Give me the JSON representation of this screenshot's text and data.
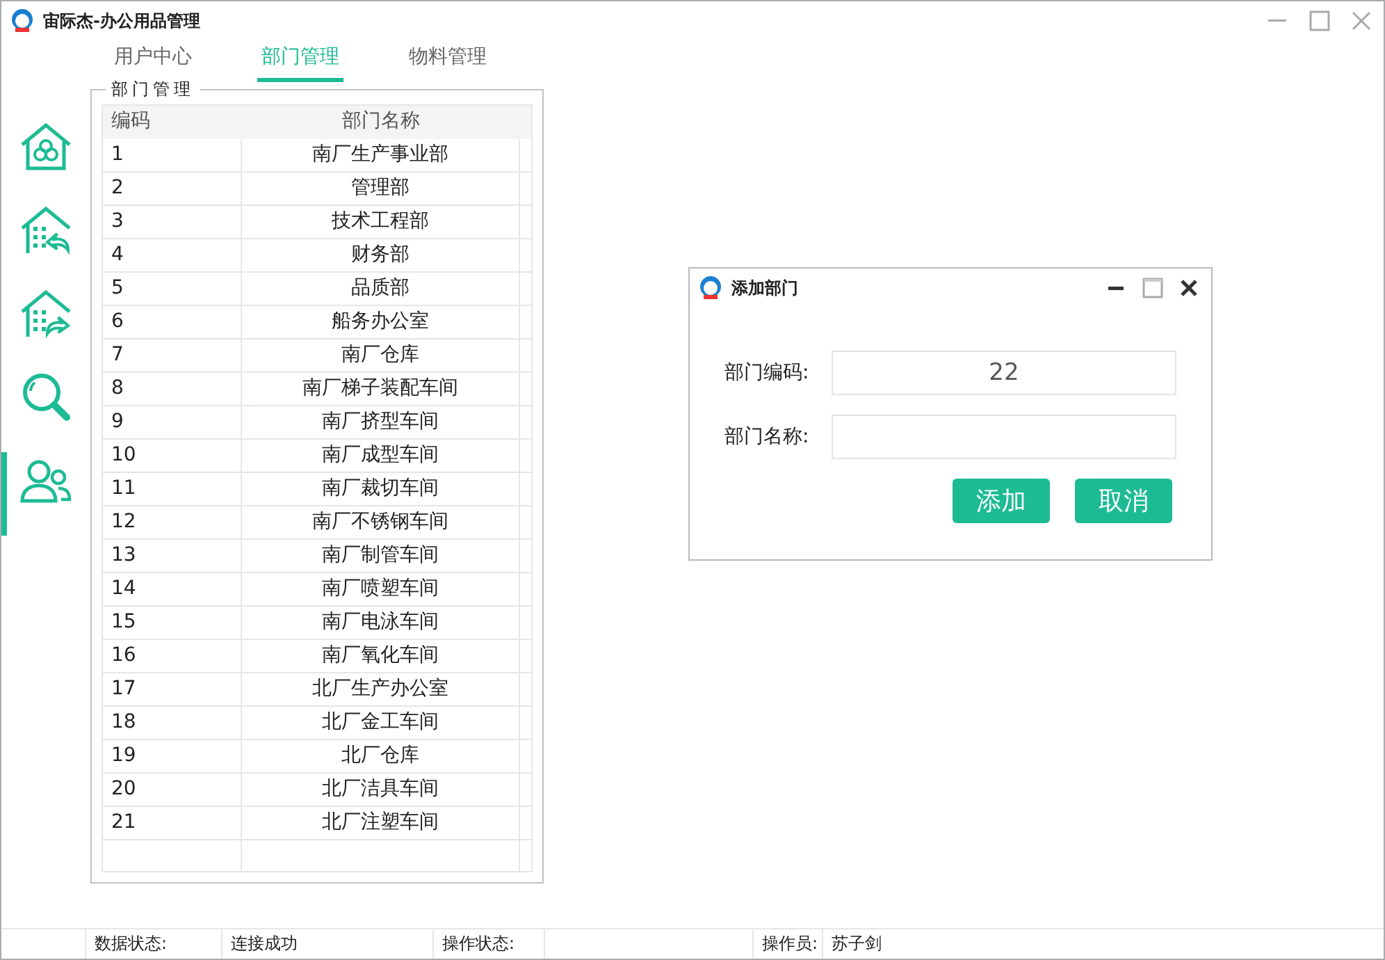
{
  "window": {
    "title": "宙际杰-办公用品管理"
  },
  "tabs": [
    {
      "label": "用户中心",
      "selected": false
    },
    {
      "label": "部门管理",
      "selected": true
    },
    {
      "label": "物料管理",
      "selected": false
    }
  ],
  "sidebar": {
    "items": [
      {
        "kind": "home",
        "selected": false
      },
      {
        "kind": "building-in",
        "selected": false
      },
      {
        "kind": "building-out",
        "selected": false
      },
      {
        "kind": "search",
        "selected": false
      },
      {
        "kind": "users",
        "selected": true
      }
    ]
  },
  "group": {
    "title": "部门管理"
  },
  "table": {
    "columns": [
      "编码",
      "部门名称"
    ],
    "rows": [
      [
        "1",
        "南厂生产事业部"
      ],
      [
        "2",
        "管理部"
      ],
      [
        "3",
        "技术工程部"
      ],
      [
        "4",
        "财务部"
      ],
      [
        "5",
        "品质部"
      ],
      [
        "6",
        "船务办公室"
      ],
      [
        "7",
        "南厂仓库"
      ],
      [
        "8",
        "南厂梯子装配车间"
      ],
      [
        "9",
        "南厂挤型车间"
      ],
      [
        "10",
        "南厂成型车间"
      ],
      [
        "11",
        "南厂裁切车间"
      ],
      [
        "12",
        "南厂不锈钢车间"
      ],
      [
        "13",
        "南厂制管车间"
      ],
      [
        "14",
        "南厂喷塑车间"
      ],
      [
        "15",
        "南厂电泳车间"
      ],
      [
        "16",
        "南厂氧化车间"
      ],
      [
        "17",
        "北厂生产办公室"
      ],
      [
        "18",
        "北厂金工车间"
      ],
      [
        "19",
        "北厂仓库"
      ],
      [
        "20",
        "北厂洁具车间"
      ],
      [
        "21",
        "北厂注塑车间"
      ]
    ]
  },
  "dialog": {
    "title": "添加部门",
    "fields": [
      {
        "label": "部门编码:",
        "value": "22"
      },
      {
        "label": "部门名称:"
      }
    ],
    "buttons": [
      "添加",
      "取消"
    ]
  },
  "status_bar": [
    {
      "label": "数据状态:",
      "value": "连接成功"
    },
    {
      "label": "操作状态:"
    },
    {
      "label": "操作员:",
      "value": "苏子剑"
    }
  ]
}
